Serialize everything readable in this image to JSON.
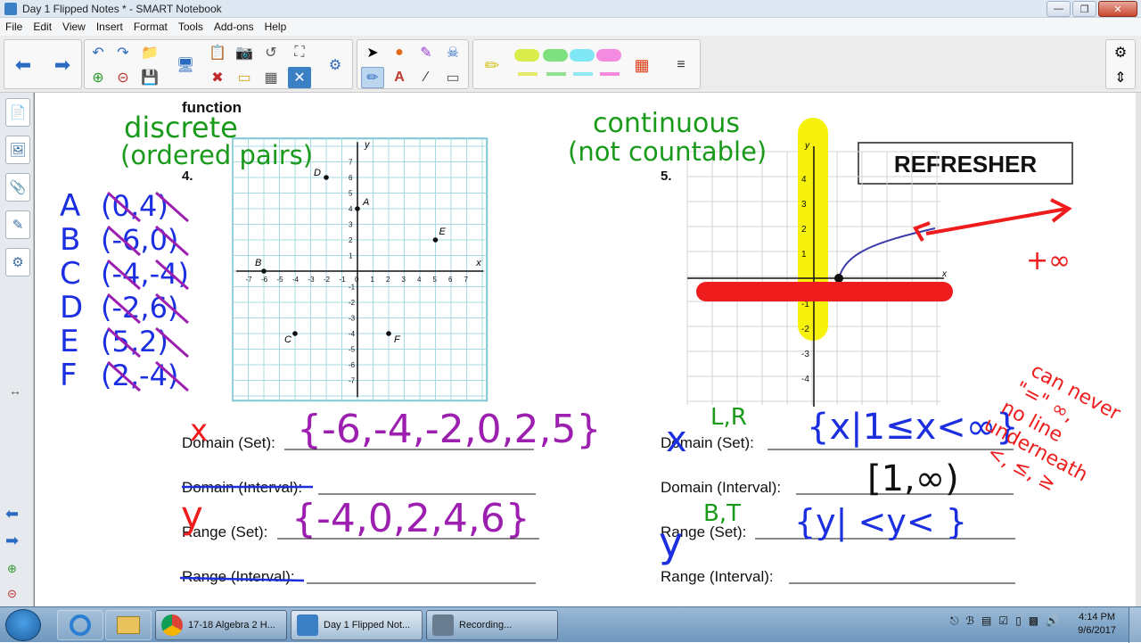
{
  "window": {
    "title": "Day 1 Flipped Notes * - SMART Notebook"
  },
  "menu": [
    "File",
    "Edit",
    "View",
    "Insert",
    "Format",
    "Tools",
    "Add-ons",
    "Help"
  ],
  "worksheet": {
    "header": "function",
    "problem4": {
      "number": "4."
    },
    "problem5": {
      "number": "5."
    },
    "refresher": "REFRESHER",
    "graph4": {
      "x_label": "x",
      "y_label": "y",
      "x_ticks": [
        "-7",
        "-6",
        "-5",
        "-4",
        "-3",
        "-2",
        "-1",
        "0",
        "1",
        "2",
        "3",
        "4",
        "5",
        "6",
        "7"
      ],
      "y_ticks": [
        "7",
        "6",
        "5",
        "4",
        "3",
        "2",
        "1",
        "-1",
        "-2",
        "-3",
        "-4",
        "-5",
        "-6",
        "-7"
      ],
      "points": [
        {
          "label": "A",
          "x": 0,
          "y": 4
        },
        {
          "label": "B",
          "x": -6,
          "y": 0
        },
        {
          "label": "C",
          "x": -4,
          "y": -4
        },
        {
          "label": "D",
          "x": -2,
          "y": 6
        },
        {
          "label": "E",
          "x": 5,
          "y": 2
        },
        {
          "label": "F",
          "x": 2,
          "y": -4
        }
      ]
    },
    "graph5": {
      "x_label": "x",
      "y_label": "y",
      "y_ticks": [
        "4",
        "3",
        "2",
        "1",
        "-1",
        "-2",
        "-3",
        "-4"
      ]
    },
    "labels_left": {
      "domain_set": "Domain (Set):",
      "domain_interval": "Domain (Interval):",
      "range_set": "Range (Set):",
      "range_interval": "Range (Interval):"
    },
    "labels_right": {
      "domain_set": "Domain (Set):",
      "domain_interval": "Domain (Interval):",
      "range_set": "Range (Set):",
      "range_interval": "Range (Interval):"
    }
  },
  "ink": {
    "discrete": "discrete",
    "ordered_pairs": "(ordered pairs)",
    "continuous": "continuous",
    "not_countable": "(not countable)",
    "pairs": [
      {
        "letter": "A",
        "pair": "(0,4)"
      },
      {
        "letter": "B",
        "pair": "(-6,0)"
      },
      {
        "letter": "C",
        "pair": "(-4,-4)"
      },
      {
        "letter": "D",
        "pair": "(-2,6)"
      },
      {
        "letter": "E",
        "pair": "(5,2)"
      },
      {
        "letter": "F",
        "pair": "(2,-4)"
      }
    ],
    "x_mark": "x",
    "domain_set_answer": "{-6,-4,-2,0,2,5}",
    "y_mark": "y",
    "range_set_answer": "{-4,0,2,4,6}",
    "lr": "L,R",
    "domain5": "{x|1≤x<∞}",
    "interval5": "[1,∞)",
    "bt": "B,T",
    "range5": "{y|    <y<    }",
    "plus_inf": "+∞",
    "note": [
      "can never",
      "\"=\" ∞,",
      "no line",
      "underneath",
      "<, ≤, ≥"
    ]
  },
  "taskbar": {
    "tasks": [
      "17-18 Algebra 2 H...",
      "Day 1 Flipped Not...",
      "Recording..."
    ],
    "time": "4:14 PM",
    "date": "9/6/2017"
  },
  "colors": {
    "green_ink": "#1a9a1a",
    "blue_ink": "#1b2fe0",
    "purple_ink": "#9c1fb0",
    "red_ink": "#ee1c1c",
    "highlight": "#f5f000"
  }
}
